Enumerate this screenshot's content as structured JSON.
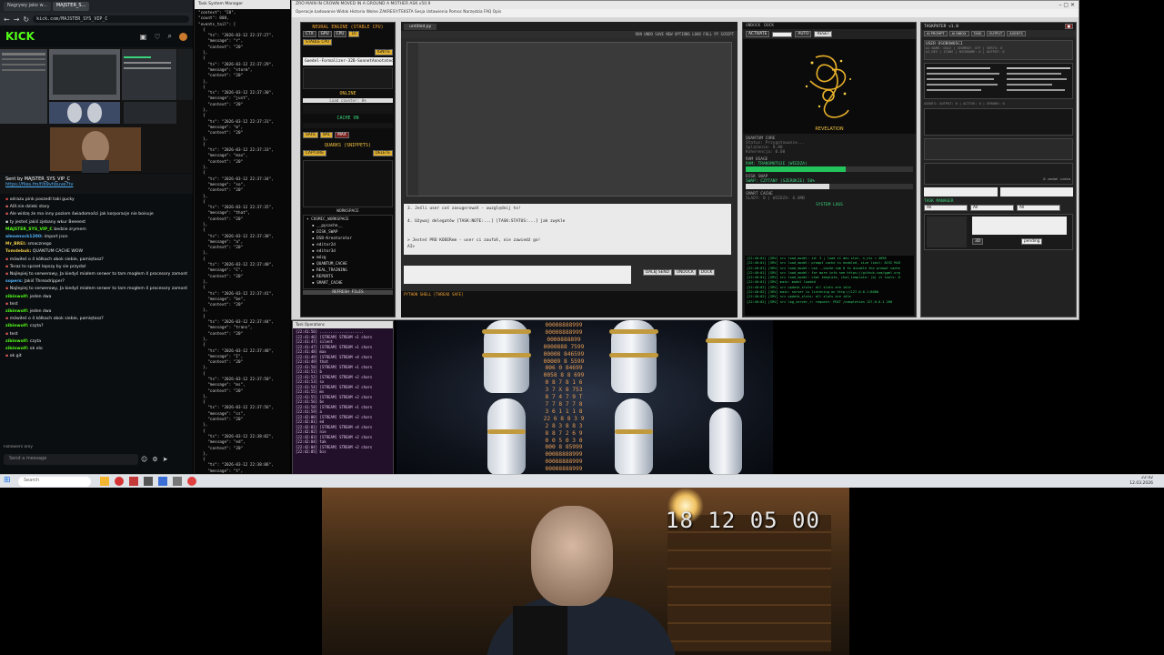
{
  "browser": {
    "tabs": [
      "Nagrywy jako w...",
      "MAJSTER_S...",
      "kick.com/MAJSTER..."
    ],
    "url": "kick.com/MAJSTER_SYS_VIP_C",
    "logo": "KICK"
  },
  "chat": {
    "pinned_label": "Sent by MAJSTER_SYS_VIP_C",
    "pinned_link": "https://files.fm/f/b9vhbuve7tv",
    "messages": [
      {
        "user": "",
        "text": "odrazu pink poszedl taki gucky",
        "color": "#e04646"
      },
      {
        "user": "",
        "text": "A0l.nie dzieki stary",
        "color": "#e06666"
      },
      {
        "user": "",
        "text": "Ale widzę że ma inny poziom świadomości jak korporacje nie boisuje",
        "color": "#e05a5a"
      },
      {
        "user": "",
        "text": "ty jesteś jakiś zjebany wkur Beeeest",
        "color": "#d9d9d9"
      },
      {
        "user": "MAJSTER_SYS_VIP_C",
        "text": "bedzie zrymem",
        "color": "#53fc18"
      },
      {
        "user": "aleoenock1200:",
        "text": "import json",
        "color": "#53b3fc"
      },
      {
        "user": "Mr_BREI:",
        "text": "smacznego",
        "color": "#e8c547"
      },
      {
        "user": "Tomdebuk:",
        "text": "QUANTUM CACHE WOW",
        "color": "#e8c547"
      },
      {
        "user": "",
        "text": "mówiłeś o 4 kółkach obok siebie, pamiętasz?",
        "color": "#e05a5a"
      },
      {
        "user": "",
        "text": "Teraz to sprzet lepszy by sie przydał",
        "color": "#e05a5a"
      },
      {
        "user": "",
        "text": "Najlepiej to serwerowy, Ja kiedyś miałem serwer to tam mogłem 4 procesory zamontować",
        "color": "#e05a5a"
      },
      {
        "user": "sopers:",
        "text": "Jakiś Threadripper?",
        "color": "#53b3fc"
      },
      {
        "user": "",
        "text": "Najlepiej to serwerowy, Ja kiedyś miałem serwer to tam mogłem 4 procesory zamontować",
        "color": "#e05a5a"
      },
      {
        "user": "zibinwolf:",
        "text": "jeden dwa",
        "color": "#53fc18"
      },
      {
        "user": "",
        "text": "test",
        "color": "#e05a5a"
      },
      {
        "user": "zibinwolf:",
        "text": "jeden dwa",
        "color": "#53fc18"
      },
      {
        "user": "",
        "text": "mówiłeś o 4 kółkach obok siebie, pamiętasz?",
        "color": "#e05a5a"
      },
      {
        "user": "zibinwolf:",
        "text": "czyta?",
        "color": "#53fc18"
      },
      {
        "user": "",
        "text": "test",
        "color": "#e05a5a"
      },
      {
        "user": "zibinwolf:",
        "text": "czyta",
        "color": "#53fc18"
      },
      {
        "user": "zibinwolf:",
        "text": "ok elo",
        "color": "#53fc18"
      },
      {
        "user": "",
        "text": "ok git",
        "color": "#e05a5a"
      }
    ],
    "followers_only": "Followers only",
    "input_placeholder": "Send a message"
  },
  "jsonlog": {
    "title": "Task System Manager",
    "lines": [
      "\"context\": \"20\",",
      "\"count\": 808,",
      "\"events_tail\": [",
      "  {",
      "    \"ts\": \"2026-03-12 22:37:27\",",
      "    \"message\": \"r\",",
      "    \"context\": \"20\"",
      "  },",
      "  {",
      "    \"ts\": \"2026-03-12 22:37:29\",",
      "    \"message\": \"storm\",",
      "    \"context\": \"20\"",
      "  },",
      "  {",
      "    \"ts\": \"2026-03-12 22:37:30\",",
      "    \"message\": \"just\",",
      "    \"context\": \"20\"",
      "  },",
      "  {",
      "    \"ts\": \"2026-03-12 22:37:31\",",
      "    \"message\": \"m\",",
      "    \"context\": \"20\"",
      "  },",
      "  {",
      "    \"ts\": \"2026-03-12 22:37:33\",",
      "    \"message\": \"max\",",
      "    \"context\": \"20\"",
      "  },",
      "  {",
      "    \"ts\": \"2026-03-12 22:37:34\",",
      "    \"message\": \"so\",",
      "    \"context\": \"20\"",
      "  },",
      "  {",
      "    \"ts\": \"2026-03-12 22:37:35\",",
      "    \"message\": \"that\",",
      "    \"context\": \"20\"",
      "  },",
      "  {",
      "    \"ts\": \"2026-03-12 22:37:38\",",
      "    \"message\": \"a\",",
      "    \"context\": \"20\"",
      "  },",
      "  {",
      "    \"ts\": \"2026-03-12 22:37:40\",",
      "    \"message\": \"C\",",
      "    \"context\": \"20\"",
      "  },",
      "  {",
      "    \"ts\": \"2026-03-12 22:37:41\",",
      "    \"message\": \"be\",",
      "    \"context\": \"20\"",
      "  },",
      "  {",
      "    \"ts\": \"2026-03-12 22:37:44\",",
      "    \"message\": \"trans\",",
      "    \"context\": \"20\"",
      "  },",
      "  {",
      "    \"ts\": \"2026-03-12 22:37:48\",",
      "    \"message\": \"I\",",
      "    \"context\": \"20\"",
      "  },",
      "  {",
      "    \"ts\": \"2026-03-12 22:37:50\",",
      "    \"message\": \"ms\",",
      "    \"context\": \"20\"",
      "  },",
      "  {",
      "    \"ts\": \"2026-03-12 22:37:56\",",
      "    \"message\": \"cs\",",
      "    \"context\": \"20\"",
      "  },",
      "  {",
      "    \"ts\": \"2026-03-12 22:38:02\",",
      "    \"message\": \"ed\",",
      "    \"context\": \"20\"",
      "  },",
      "  {",
      "    \"ts\": \"2026-03-12 22:38:06\",",
      "    \"message\": \"t\","
    ]
  },
  "mainwin": {
    "title": "ZRÓ MAIN IN CROWN MOVED IN A GROUND A MOTHER ASK v50.9",
    "menu": "Operacje   Ładowanie   Widok   Historia   Wolne   ZAKRESY/TEKSTA   Sesja   Ustawienia   Pomoc   Narzędzia   FAQ   Opis"
  },
  "neural": {
    "title": "NEURAL ENGINE (STABLE CPU)",
    "buttons": [
      "CTX",
      "GPU",
      "CPU",
      "16"
    ],
    "stable_label": "STABLE CPU",
    "ignite": "IGNITE",
    "model": "Goedel-Formalizer-32B-SonnetAnnotated",
    "status": "ONLINE",
    "load": "Load counter: 0%",
    "cache_label": "CACHE ON",
    "safe": "SAFE",
    "bal": "BAL",
    "max": "MAX",
    "quarks_title": "QUARKS (SNIPPETS)",
    "capture": "CAPTURE",
    "delete": "DELETE",
    "workspace_title": "WORKSPACE",
    "workspace_items": [
      "COSMIC_WORKSPACE",
      "__pycache__",
      "DISK_SWAP",
      "DSB-Kreatorator",
      "editor2d",
      "editor3d",
      "mózg",
      "QUANTUM_CACHE",
      "REAL_TRAINING",
      "REPORTS",
      "SMART_CACHE"
    ],
    "refresh": "REFRESH FILES"
  },
  "editor": {
    "file_tab": "untitled.py",
    "toolbar": "RUN   UNDO   SAVE   NEW   OPTIONS   LOAD   FULL   PY   SCRIPT",
    "output_lines": [
      "3. Jeśli user coś zasugerował - uwzględnij to!",
      "",
      "4. Używaj delegatów [TASK:NOTE:...] [TASK:STATUS:...] jak zwykle",
      "",
      "",
      "> Jesteś PRO KODERem - user ci zaufał, nie zawiedź go!",
      "AI>"
    ],
    "dalej_send": "DALEJ SEND",
    "undock": "UNDOCK",
    "dock": "DOCK",
    "shell_label": "PYTHON SHELL [THREAD SAFE]"
  },
  "rightpanel": {
    "undock": "UNDOCK",
    "dock": "DOCK",
    "activate": "ACTIVATE",
    "auto": "AUTO",
    "reset": "RESET",
    "revelation": "REVELATION",
    "quantum_core": "QUANTUM CORE",
    "qc_lines": [
      "Status: Przygotowanie...",
      "Splątanie: 0.00",
      "Koherencja: 0.00"
    ],
    "ram_usage": "RAM USAGE",
    "ram_label": "RAM: TRANSMUTUJE (WIEDZA)",
    "ram_fill": 0.6,
    "disk_swap": "DISK SWAP",
    "swap_label": "SWAP: CZYTANY (SZEROKIE) 50%",
    "swap_fill": 0.5,
    "smart_cache": "SMART CACHE",
    "slady": "ŚLADY: 0 | WIEDZA: 0.0MB",
    "system_logs": "SYSTEM LOGS",
    "log_lines": [
      "[22:40:01] [SRV] src   load_model: id: 3 | load c1 dev slot, n_ctx = 4096",
      "[22:40:01] [SRV] src   load_model: prompt cache is enabled, size limit: 8192 MiB",
      "[22:40:01] [SRV] src   load_model: use --cache-ram 0 to disable the prompt cache",
      "[22:40:01] [SRV] src   load_model: for more info see https://github.com/ggml-org",
      "[22:40:01] [SRV] src   load_model: chat template, chat_template: (b) it tools: 0",
      "[22:40:01] [SRV] main: model loaded",
      "[22:40:02] [SRV] src   update_slots: all slots are idle",
      "[22:40:02] [SRV] main: server is listening on http://127.0.0.1:8080",
      "[22:40:02] [SRV] src   update_slots: all slots are idle",
      "[22:40:02] [SRV] src   log_server_r: request: POST /completion 127.0.0.1 200"
    ]
  },
  "taskputer": {
    "title": "TASKPUTER v1.0",
    "header_tabs": [
      "AI PROMPT",
      "AI INBOX",
      "TASK",
      "OUTPUT",
      "AGENTS"
    ],
    "user_label": "USER OSOBOWOŚCI",
    "lines": [
      "AI NAME: DOLE | SEGMENT: UTF | VERTS: 0",
      "AI_DEV | ICONS | NICKNAME: 0 | OUTPUT: 0",
      "AGENTS: OUTPUT: 0 | ACTIVE: 0 | ERRORS: 0"
    ],
    "zero_tasks": "0 zadań czeka",
    "task_manager": "TASK MANAGER",
    "all1": "All",
    "all2": "All",
    "all3": "All",
    "btn3d": "3D",
    "status": "pending"
  },
  "streamlog": {
    "title": "Task Operations",
    "lines": [
      "[22:41:56] ....................",
      "[22:41:46] [STREAM] STREAM +1 chars",
      "[22:41:47] silent",
      "[22:41:47] [STREAM] STREAM +1 chars",
      "[22:41:48] max",
      "[22:41:49] [STREAM] STREAM +4 chars",
      "[22:41:49] that",
      "[22:41:50] [STREAM] STREAM +1 chars",
      "[22:41:51] b",
      "[22:41:52] [STREAM] STREAM +2 chars",
      "[22:41:53] sx",
      "[22:41:54] [STREAM] STREAM +2 chars",
      "[22:41:55] ms",
      "[22:41:55] [STREAM] STREAM +2 chars",
      "[22:41:56] bs",
      "[22:41:58] [STREAM] STREAM +1 chars",
      "[22:41:59] a",
      "[22:42:00] [STREAM] STREAM +2 chars",
      "[22:42:01] ed",
      "[22:42:01] [STREAM] STREAM +4 chars",
      "[22:42:02] nie",
      "[22:42:03] [STREAM] STREAM +2 chars",
      "[22:42:04] tak",
      "[22:42:04] [STREAM] STREAM +2 chars",
      "[22:42:05] bis"
    ]
  },
  "art": {
    "numbers": "ΘΘΘΘ8888999\nΘΘΘΘ8888999\nΘΘΘΘ888899\nΘΘΘΘ888 7599\nΘΘΘΘ8 846599\nΘΘΘΘ9 8 5599\nΘΘ6 Θ 84699\nΘΘ58 8 8 699\nΘ 8 7 8 1 6\n3 7 X 8 753\n8 7 4 7 9 T\n7 7 8 7 7 8\n3 6 1 1 1 8\n22 6 8 8 3 9\n2 8 3 8 8 3\n8 8 7 2 6 9\nΘ Θ 5 Θ 3 Θ\nΘΘΘ 8 85999\nΘΘΘ88888999\nΘΘΘ88888999\nΘΘΘΘ8888999"
  },
  "taskbar": {
    "search": "Search",
    "time": "22:42",
    "date": "12.03.2026"
  },
  "webcam": {
    "timestamp": "18 12 05 00"
  }
}
